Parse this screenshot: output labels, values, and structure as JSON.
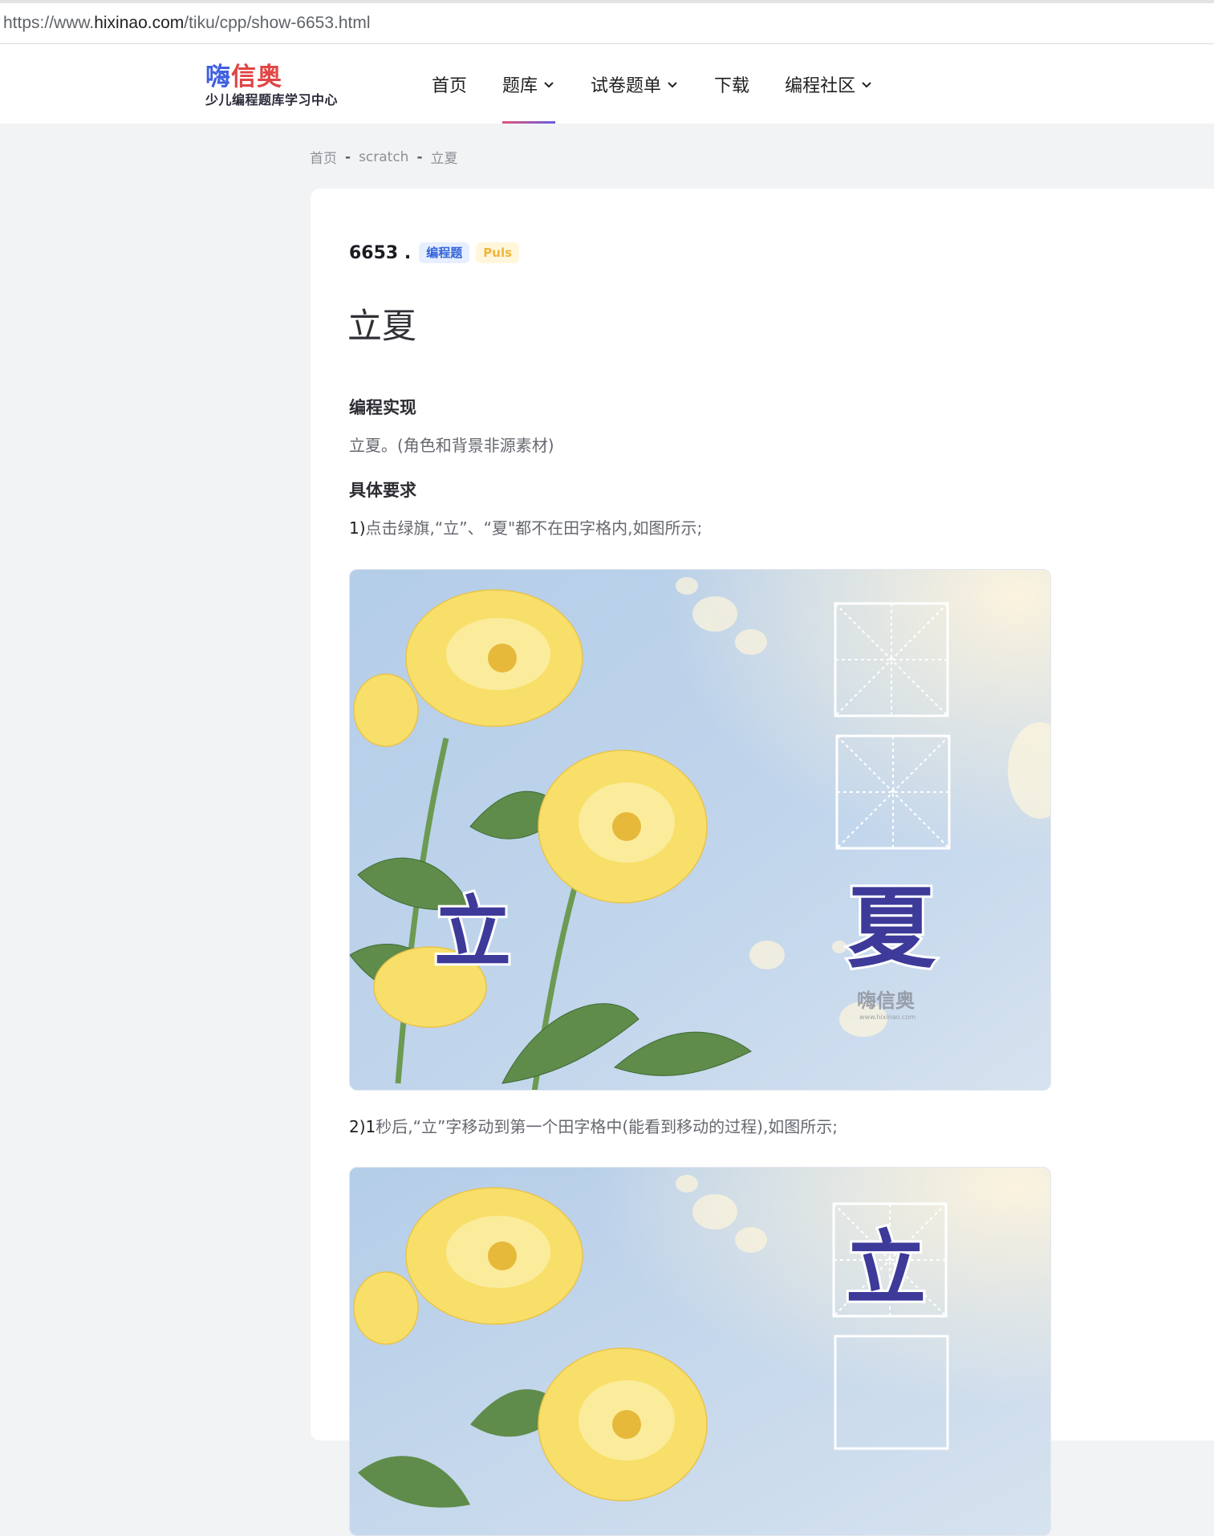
{
  "browser": {
    "url_prefix": "https://www.",
    "url_host": "hixinao.com",
    "url_path": "/tiku/cpp/show-6653.html"
  },
  "header": {
    "logo_char1": "嗨",
    "logo_rest": "信奥",
    "logo_tagline": "少儿编程题库学习中心",
    "nav": [
      {
        "label": "首页",
        "dropdown": false
      },
      {
        "label": "题库",
        "dropdown": true,
        "active": true
      },
      {
        "label": "试卷题单",
        "dropdown": true
      },
      {
        "label": "下载",
        "dropdown": false
      },
      {
        "label": "编程社区",
        "dropdown": true
      }
    ],
    "accent": "#6a5ce0"
  },
  "breadcrumb": [
    "首页",
    "scratch",
    "立夏"
  ],
  "question": {
    "number": "6653 .",
    "type_badge": "编程题",
    "plus_badge": "Puls",
    "title": "立夏"
  },
  "sections": {
    "impl_heading": "编程实现",
    "impl_text": "立夏。(角色和背景非源素材)",
    "req_heading": "具体要求",
    "req1_lead": "1)",
    "req1_text": "点击绿旗,“立”、“夏\"都不在田字格内,如图所示;",
    "req2_lead": "2)1",
    "req2_text": "秒后,“立”字移动到第一个田字格中(能看到移动的过程),如图所示;"
  },
  "figures": {
    "char_li": "立",
    "char_xia": "夏",
    "watermark": "嗨信奥",
    "watermark_url": "www.hixinao.com",
    "sky_color": "#b8d0ea",
    "flower_color": "#f8df6a",
    "char_color": "#3d3a9a"
  }
}
